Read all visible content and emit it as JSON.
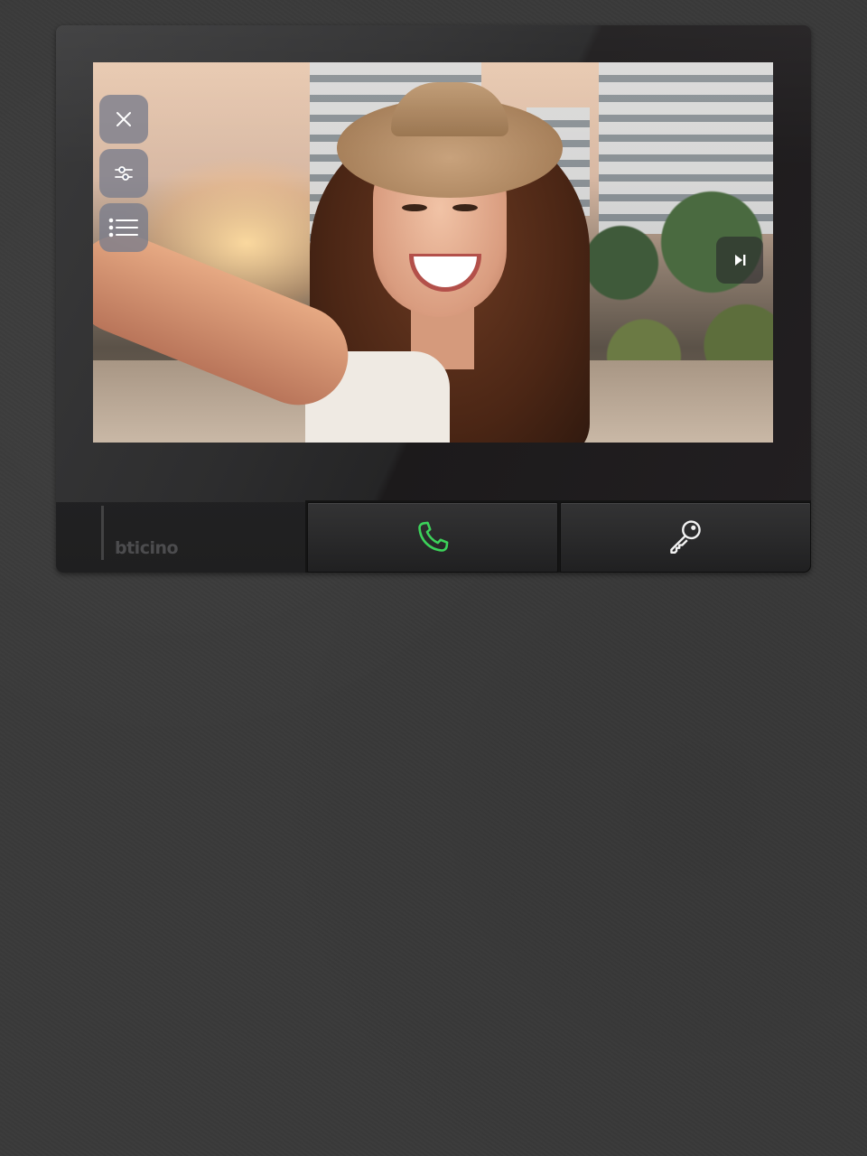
{
  "brand": "bticino",
  "screen": {
    "overlay_buttons": [
      {
        "name": "close",
        "icon": "close-icon"
      },
      {
        "name": "settings",
        "icon": "sliders-icon"
      },
      {
        "name": "list",
        "icon": "list-icon"
      }
    ],
    "skip_button": {
      "icon": "skip-next-icon"
    }
  },
  "keys": [
    {
      "name": "answer-call",
      "icon": "phone-icon",
      "color": "#3cd25a"
    },
    {
      "name": "door-unlock",
      "icon": "key-icon",
      "color": "#f2f2f2"
    }
  ],
  "colors": {
    "call_green": "#3cd25a",
    "overlay_button": "#787c8c",
    "device_body": "#232324",
    "wall": "#3a3a3a"
  }
}
